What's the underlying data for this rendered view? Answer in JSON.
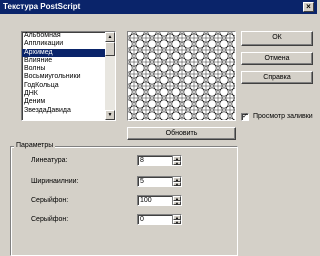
{
  "window": {
    "title": "Текстура PostScript",
    "close_glyph": "×"
  },
  "textures": {
    "items": [
      "Альбомная",
      "Аппликации",
      "Архимед",
      "Влияние",
      "Волны",
      "Восьмиугольники",
      "ГодКольца",
      "ДНК",
      "Деним",
      "ЗвездаДавида"
    ],
    "selected_index": 2
  },
  "buttons": {
    "ok": "ОК",
    "cancel": "Отмена",
    "help": "Справка",
    "refresh": "Обновить"
  },
  "preview_checkbox": {
    "label": "Просмотр заливки",
    "checked": true,
    "mark": "✓"
  },
  "params": {
    "legend": "Параметры",
    "rows": [
      {
        "label": "Линеатура:",
        "value": "8"
      },
      {
        "label": "Ширинаилнии:",
        "value": "5"
      },
      {
        "label": "Серыйфон:",
        "value": "100"
      },
      {
        "label": "Серыйфон:",
        "value": "0"
      }
    ]
  },
  "colors": {
    "face": "#d4d0c8",
    "title_bar": "#0a246a",
    "selection": "#0a246a"
  }
}
